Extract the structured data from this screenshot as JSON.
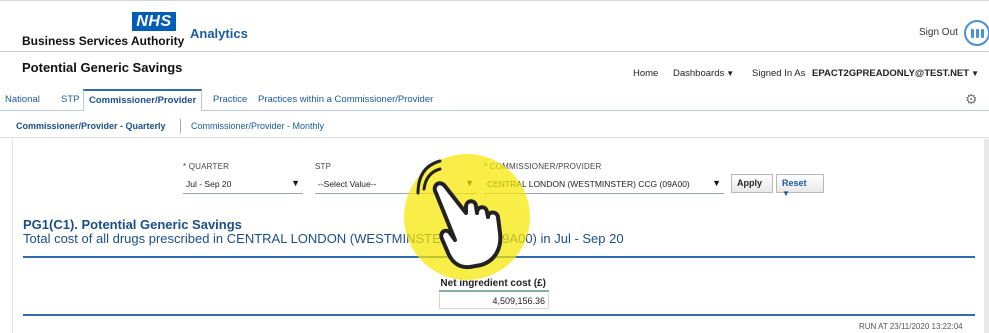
{
  "header": {
    "logo_text": "NHS",
    "org_name": "Business Services Authority",
    "app_title": "Analytics",
    "sign_out": "Sign Out"
  },
  "dashbar": {
    "page_title": "Potential Generic Savings",
    "home": "Home",
    "dashboards": "Dashboards",
    "signed_in_as": "Signed In As",
    "user": "EPACT2GPREADONLY@TEST.NET"
  },
  "tabs": [
    {
      "label": "National"
    },
    {
      "label": "STP"
    },
    {
      "label": "Commissioner/Provider"
    },
    {
      "label": "Practice"
    },
    {
      "label": "Practices within a Commissioner/Provider"
    }
  ],
  "subtabs": [
    {
      "label": "Commissioner/Provider - Quarterly"
    },
    {
      "label": "Commissioner/Provider - Monthly"
    }
  ],
  "prompts": {
    "quarter": {
      "label": "* QUARTER",
      "value": "Jul - Sep 20"
    },
    "stp": {
      "label": "STP",
      "value": "--Select Value--"
    },
    "commissioner": {
      "label": "* COMMISSIONER/PROVIDER",
      "value": "CENTRAL LONDON (WESTMINSTER) CCG (09A00)"
    },
    "apply": "Apply",
    "reset": "Reset"
  },
  "report": {
    "title": "PG1(C1). Potential Generic Savings",
    "subtitle": "Total cost of all drugs prescribed in CENTRAL LONDON (WESTMINSTER) CCG (09A00) in Jul - Sep 20",
    "metric_header": "Net ingredient cost (£)",
    "metric_value": "4,509,156.36",
    "run_at": "RUN AT 23/11/2020 13:22:04"
  },
  "colors": {
    "nhs_blue": "#005eb8",
    "link_blue": "#1a5aa6",
    "highlight_yellow": "#f7e600"
  },
  "icons": {
    "user": "user-avatar-icon",
    "settings": "gear-icon",
    "cursor": "tap-hand-icon"
  }
}
